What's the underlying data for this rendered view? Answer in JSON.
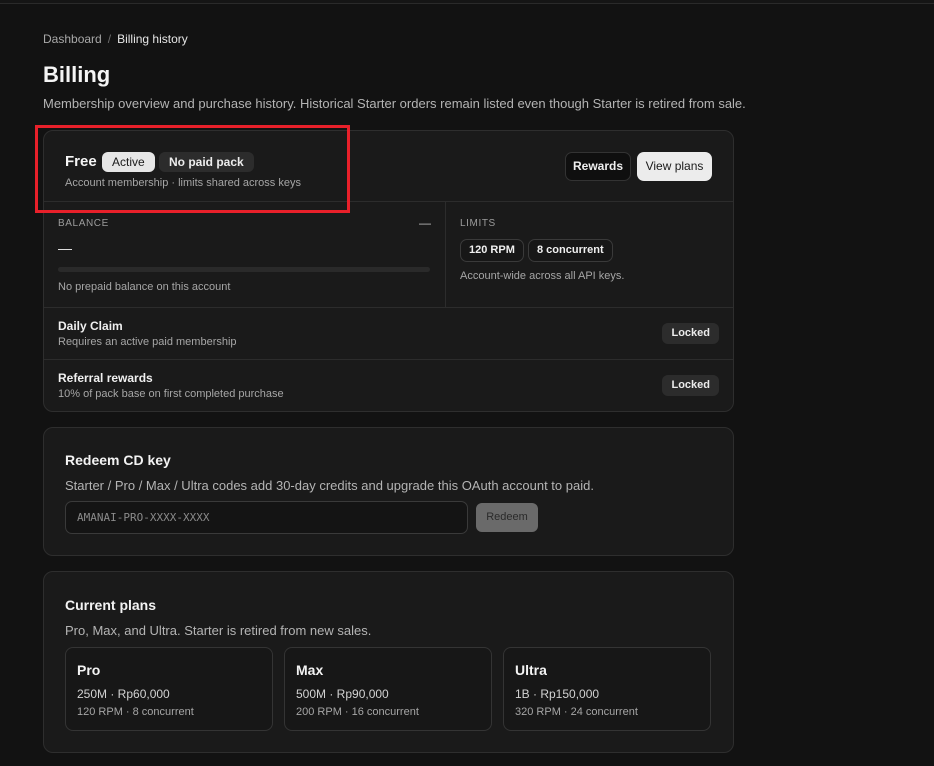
{
  "breadcrumb": {
    "parent": "Dashboard",
    "separator": "/",
    "current": "Billing history"
  },
  "page": {
    "title": "Billing",
    "subtitle": "Membership overview and purchase history. Historical Starter orders remain listed even though Starter is retired from sale."
  },
  "membership": {
    "plan": "Free",
    "status_badge": "Active",
    "pack_badge": "No paid pack",
    "subtitle": "Account membership · limits shared across keys",
    "rewards_button": "Rewards",
    "view_plans_button": "View plans"
  },
  "balance": {
    "label": "BALANCE",
    "right_value": "—",
    "value": "—",
    "progress": 0,
    "note": "No prepaid balance on this account"
  },
  "limits": {
    "label": "LIMITS",
    "rpm": "120 RPM",
    "concurrent": "8 concurrent",
    "note": "Account-wide across all API keys."
  },
  "rows": [
    {
      "title": "Daily Claim",
      "subtitle": "Requires an active paid membership",
      "status": "Locked"
    },
    {
      "title": "Referral rewards",
      "subtitle": "10% of pack base on first completed purchase",
      "status": "Locked"
    }
  ],
  "redeem": {
    "title": "Redeem CD key",
    "description": "Starter / Pro / Max / Ultra codes add 30-day credits and upgrade this OAuth account to paid.",
    "placeholder": "AMANAI-PRO-XXXX-XXXX",
    "button": "Redeem"
  },
  "current_plans": {
    "title": "Current plans",
    "description": "Pro, Max, and Ultra. Starter is retired from new sales.",
    "plans": [
      {
        "name": "Pro",
        "price": "250M · Rp60,000",
        "limits": "120 RPM · 8 concurrent"
      },
      {
        "name": "Max",
        "price": "500M · Rp90,000",
        "limits": "200 RPM · 16 concurrent"
      },
      {
        "name": "Ultra",
        "price": "1B · Rp150,000",
        "limits": "320 RPM · 24 concurrent"
      }
    ]
  },
  "colors": {
    "background": "#121212",
    "card": "#1a1a1a",
    "highlight": "#e8202a"
  }
}
